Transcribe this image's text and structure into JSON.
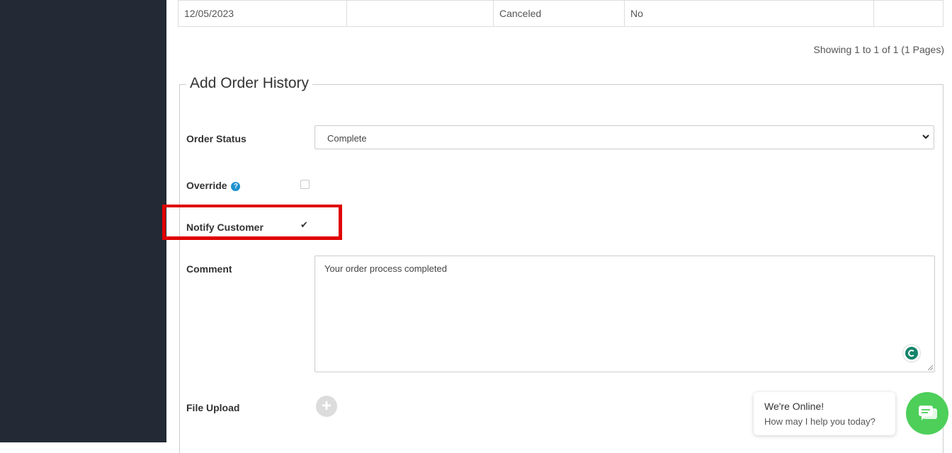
{
  "history_table": {
    "row": {
      "date": "12/05/2023",
      "comment": "",
      "status": "Canceled",
      "notified": "No",
      "action": ""
    }
  },
  "pagination_info": "Showing 1 to 1 of 1 (1 Pages)",
  "add_history": {
    "legend": "Add Order History",
    "order_status_label": "Order Status",
    "order_status_value": "Complete",
    "override_label": "Override",
    "override_checked": false,
    "notify_label": "Notify Customer",
    "notify_checked": true,
    "comment_label": "Comment",
    "comment_value": "Your order process completed",
    "file_upload_label": "File Upload"
  },
  "chat_widget": {
    "title": "We're Online!",
    "subtitle": "How may I help you today?"
  },
  "icons": {
    "help": "question-circle-icon",
    "checkmark": "check-icon",
    "upload": "plus-circle-icon",
    "chat": "chat-bubbles-icon"
  },
  "colors": {
    "sidebar": "#232a35",
    "highlight": "#e00000",
    "help_icon": "#1e91cf",
    "chat_launcher": "#4dcf5a",
    "grammarly": "#15846b"
  }
}
